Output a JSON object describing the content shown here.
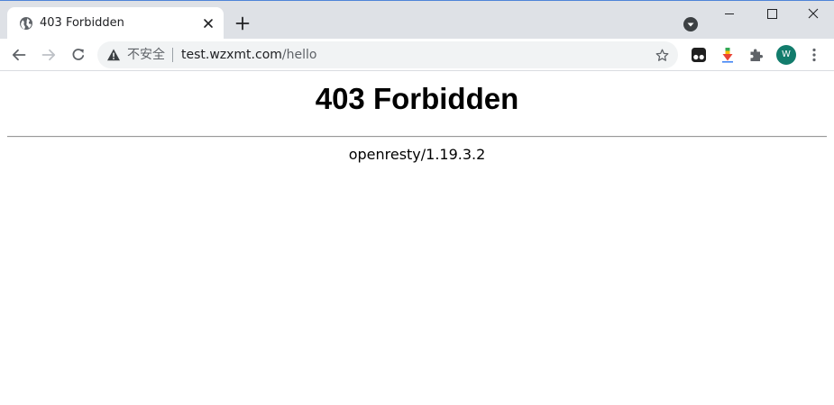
{
  "browser": {
    "tab": {
      "title": "403 Forbidden",
      "favicon": "globe-icon"
    },
    "toolbar": {
      "security_label": "不安全",
      "url_host": "test.wzxmt.com",
      "url_path": "/hello"
    },
    "profile": {
      "initial": "W",
      "color": "#127c6c"
    },
    "extensions": [
      "tampermonkey-icon",
      "download-arrow-icon",
      "puzzle-icon"
    ]
  },
  "page": {
    "heading": "403 Forbidden",
    "server": "openresty/1.19.3.2"
  }
}
